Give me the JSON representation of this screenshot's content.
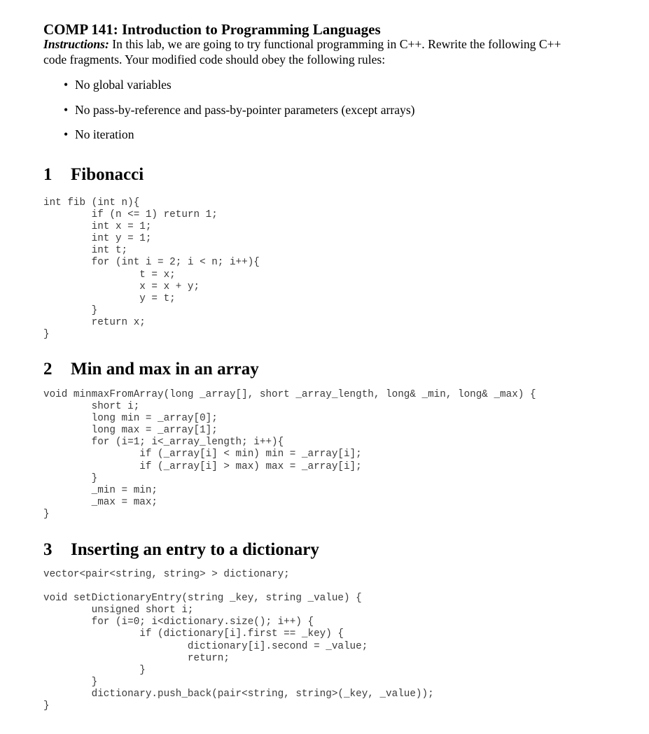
{
  "document": {
    "title": "COMP 141: Introduction to Programming Languages",
    "instructions_label": "Instructions:",
    "instructions_line1": " In this lab, we are going to try functional programming in C++. Rewrite the following C++",
    "instructions_line2": "code fragments. Your modified code should obey the following rules:",
    "rules": [
      "No global variables",
      "No pass-by-reference and pass-by-pointer parameters (except arrays)",
      "No iteration"
    ],
    "bullet_glyph": "•"
  },
  "sections": [
    {
      "number": "1",
      "title": "Fibonacci",
      "code": [
        "int fib (int n){",
        "        if (n <= 1) return 1;",
        "        int x = 1;",
        "        int y = 1;",
        "        int t;",
        "        for (int i = 2; i < n; i++){",
        "                t = x;",
        "                x = x + y;",
        "                y = t;",
        "        }",
        "        return x;",
        "}"
      ]
    },
    {
      "number": "2",
      "title": "Min and max in an array",
      "code": [
        "void minmaxFromArray(long _array[], short _array_length, long& _min, long& _max) {",
        "        short i;",
        "        long min = _array[0];",
        "        long max = _array[1];",
        "        for (i=1; i<_array_length; i++){",
        "                if (_array[i] < min) min = _array[i];",
        "                if (_array[i] > max) max = _array[i];",
        "        }",
        "        _min = min;",
        "        _max = max;",
        "}"
      ]
    },
    {
      "number": "3",
      "title": "Inserting an entry to a dictionary",
      "code": [
        "vector<pair<string, string> > dictionary;",
        "",
        "void setDictionaryEntry(string _key, string _value) {",
        "        unsigned short i;",
        "        for (i=0; i<dictionary.size(); i++) {",
        "                if (dictionary[i].first == _key) {",
        "                        dictionary[i].second = _value;",
        "                        return;",
        "                }",
        "        }",
        "        dictionary.push_back(pair<string, string>(_key, _value));",
        "}"
      ]
    }
  ]
}
